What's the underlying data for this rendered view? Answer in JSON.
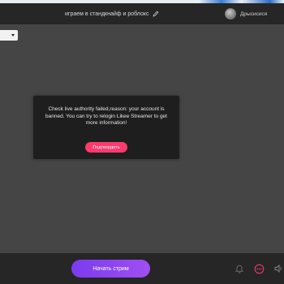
{
  "header": {
    "stream_title": "играем в стандкнайф и роблокс",
    "username": "Дрысисися"
  },
  "dialog": {
    "message": "Check live authority failed,reason: your account is banned. You can try to relogin Likee Streamer to get more information!",
    "confirm_label": "Подтвердить"
  },
  "footer": {
    "start_label": "Начать стрим"
  },
  "icons": {
    "edit": "pencil-icon",
    "bell": "bell-icon",
    "chat": "chat-icon",
    "speaker": "speaker-icon"
  },
  "colors": {
    "accent_pink": "#ff3a6e",
    "start_gradient_from": "#7a3bf0",
    "start_gradient_to": "#a04ff2"
  }
}
